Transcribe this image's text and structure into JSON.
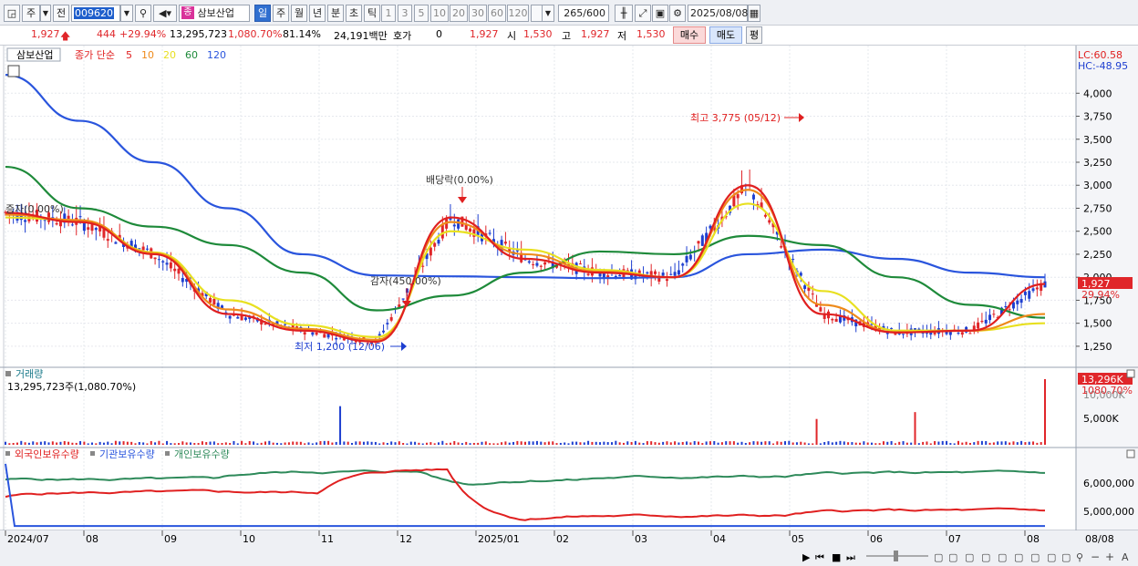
{
  "toolbar": {
    "period_short": "주",
    "prev_label": "전",
    "stock_code": "009620",
    "stock_badge": "종",
    "stock_name": "삼보산업",
    "tabs": [
      "일",
      "주",
      "월",
      "년",
      "분",
      "초",
      "틱"
    ],
    "active_tab": "일",
    "intervals": [
      "1",
      "3",
      "5",
      "10",
      "20",
      "30",
      "60",
      "120"
    ],
    "count": "265",
    "count_total": "/600",
    "date": "2025/08/08"
  },
  "quote": {
    "price": "1,927",
    "change": "444",
    "change_pct": "+29.94%",
    "volume": "13,295,723",
    "volume_pct": "1,080.70%",
    "turnover_pct": "81.14%",
    "amount": "24,191백만",
    "hoga_label": "호가",
    "hoga_value": "0",
    "bid_price": "1,927",
    "open_label": "시",
    "open": "1,530",
    "high_label": "고",
    "high": "1,927",
    "low_label": "저",
    "low": "1,530",
    "buy_label": "매수",
    "sell_label": "매도",
    "eval_label": "평"
  },
  "price_panel": {
    "stock_label": "삼보산업",
    "ma_label": "종가 단순",
    "ma_periods": [
      {
        "period": "5",
        "color": "#e02020"
      },
      {
        "period": "10",
        "color": "#ee8a1a"
      },
      {
        "period": "20",
        "color": "#e8e020"
      },
      {
        "period": "60",
        "color": "#1e8a3a"
      },
      {
        "period": "120",
        "color": "#2a55dd"
      }
    ],
    "lc": "LC:60.58",
    "hc": "HC:-48.95",
    "price_ticks": [
      "4,000",
      "3,750",
      "3,500",
      "3,250",
      "3,000",
      "2,750",
      "2,500",
      "2,250",
      "2,000",
      "1,750",
      "1,500",
      "1,250"
    ],
    "current_price": "1,927",
    "current_pct": "29.94%",
    "annotations": {
      "high": "최고 3,775 (05/12)",
      "low": "최저 1,200 (12/06)",
      "dividend": "배당락(0.00%)",
      "capital_reduction": "감자(450.00%)",
      "left_event": "증자(0.00%)"
    }
  },
  "volume_panel": {
    "title": "거래량",
    "value": "13,295,723주(1,080.70%)",
    "tick": "5,000K",
    "badge_value": "13,296K",
    "badge_pct": "1080.70%",
    "hidden_tick": "10,000K"
  },
  "holding_panel": {
    "series": [
      {
        "name": "외국인보유수량",
        "color": "#e02020"
      },
      {
        "name": "기관보유수량",
        "color": "#2a55dd"
      },
      {
        "name": "개인보유수량",
        "color": "#2e8a5a"
      }
    ],
    "ticks": [
      "6,000,000",
      "5,000,000"
    ]
  },
  "x_axis": {
    "labels": [
      "2024/07",
      "08",
      "09",
      "10",
      "11",
      "12",
      "2025/01",
      "02",
      "03",
      "04",
      "05",
      "06",
      "07",
      "08"
    ],
    "right_label": "08/08"
  },
  "colors": {
    "up": "#e0262a",
    "down": "#1e3fd0",
    "ma5": "#e02020",
    "ma10": "#ee8a1a",
    "ma20": "#e8e020",
    "ma60": "#1e8a3a",
    "ma120": "#2a55dd"
  },
  "chart_data": {
    "type": "line",
    "title": "삼보산업",
    "x_dates": [
      "2024/07",
      "08",
      "09",
      "10",
      "11",
      "12",
      "2025/01",
      "02",
      "03",
      "04",
      "05",
      "06",
      "07",
      "08"
    ],
    "price_range": [
      1150,
      4300
    ],
    "series": [
      {
        "name": "5",
        "values": [
          2700,
          2600,
          2250,
          1600,
          1420,
          1300,
          2650,
          2200,
          2050,
          2000,
          3000,
          1600,
          1400,
          1420,
          1927
        ]
      },
      {
        "name": "10",
        "values": [
          2680,
          2620,
          2260,
          1650,
          1440,
          1320,
          2600,
          2250,
          2060,
          2000,
          2950,
          1700,
          1400,
          1420,
          1600
        ]
      },
      {
        "name": "20",
        "values": [
          2650,
          2620,
          2270,
          1750,
          1480,
          1350,
          2500,
          2300,
          2080,
          2000,
          2800,
          1850,
          1420,
          1420,
          1500
        ]
      },
      {
        "name": "60",
        "values": [
          3200,
          2750,
          2550,
          2350,
          2050,
          1640,
          1800,
          2050,
          2280,
          2250,
          2450,
          2350,
          2000,
          1700,
          1560
        ]
      },
      {
        "name": "120",
        "values": [
          4200,
          3700,
          3250,
          2750,
          2250,
          2020,
          2010,
          2000,
          1990,
          2000,
          2250,
          2300,
          2200,
          2050,
          2000
        ]
      }
    ],
    "volume": {
      "latest": 13295723,
      "latest_pct": 1080.7
    },
    "holdings": {
      "foreign_range": [
        4500000,
        6800000
      ],
      "individual_range": [
        5800000,
        6700000
      ]
    }
  }
}
